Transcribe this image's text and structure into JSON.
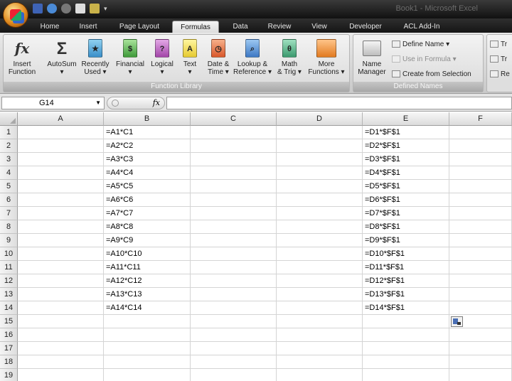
{
  "window": {
    "title": "Book1 - Microsoft Excel"
  },
  "tabs": [
    "Home",
    "Insert",
    "Page Layout",
    "Formulas",
    "Data",
    "Review",
    "View",
    "Developer",
    "ACL Add-In"
  ],
  "active_tab": "Formulas",
  "ribbon": {
    "function_library": {
      "label": "Function Library",
      "buttons": [
        {
          "line1": "Insert",
          "line2": "Function"
        },
        {
          "line1": "AutoSum",
          "line2": "▾"
        },
        {
          "line1": "Recently",
          "line2": "Used ▾"
        },
        {
          "line1": "Financial",
          "line2": "▾"
        },
        {
          "line1": "Logical",
          "line2": "▾"
        },
        {
          "line1": "Text",
          "line2": "▾"
        },
        {
          "line1": "Date &",
          "line2": "Time ▾"
        },
        {
          "line1": "Lookup &",
          "line2": "Reference ▾"
        },
        {
          "line1": "Math",
          "line2": "& Trig ▾"
        },
        {
          "line1": "More",
          "line2": "Functions ▾"
        }
      ]
    },
    "defined_names": {
      "label": "Defined Names",
      "name_manager": {
        "line1": "Name",
        "line2": "Manager"
      },
      "define_name": "Define Name ▾",
      "use_in_formula": "Use in Formula ▾",
      "create_from_selection": "Create from Selection"
    },
    "formula_auditing": {
      "items": [
        "Tr",
        "Tr",
        "Re"
      ]
    }
  },
  "name_box": "G14",
  "formula_bar": {
    "fx": "fx",
    "content": ""
  },
  "columns": [
    "A",
    "B",
    "C",
    "D",
    "E",
    "F"
  ],
  "rows": [
    {
      "n": "1",
      "B": "=A1*C1",
      "E": "=D1*$F$1"
    },
    {
      "n": "2",
      "B": "=A2*C2",
      "E": "=D2*$F$1"
    },
    {
      "n": "3",
      "B": "=A3*C3",
      "E": "=D3*$F$1"
    },
    {
      "n": "4",
      "B": "=A4*C4",
      "E": "=D4*$F$1"
    },
    {
      "n": "5",
      "B": "=A5*C5",
      "E": "=D5*$F$1"
    },
    {
      "n": "6",
      "B": "=A6*C6",
      "E": "=D6*$F$1"
    },
    {
      "n": "7",
      "B": "=A7*C7",
      "E": "=D7*$F$1"
    },
    {
      "n": "8",
      "B": "=A8*C8",
      "E": "=D8*$F$1"
    },
    {
      "n": "9",
      "B": "=A9*C9",
      "E": "=D9*$F$1"
    },
    {
      "n": "10",
      "B": "=A10*C10",
      "E": "=D10*$F$1"
    },
    {
      "n": "11",
      "B": "=A11*C11",
      "E": "=D11*$F$1"
    },
    {
      "n": "12",
      "B": "=A12*C12",
      "E": "=D12*$F$1"
    },
    {
      "n": "13",
      "B": "=A13*C13",
      "E": "=D13*$F$1"
    },
    {
      "n": "14",
      "B": "=A14*C14",
      "E": "=D14*$F$1"
    },
    {
      "n": "15",
      "B": "",
      "E": ""
    },
    {
      "n": "16",
      "B": "",
      "E": ""
    },
    {
      "n": "17",
      "B": "",
      "E": ""
    },
    {
      "n": "18",
      "B": "",
      "E": ""
    },
    {
      "n": "19",
      "B": "",
      "E": ""
    }
  ],
  "colors": {
    "accent": "#e08a1e",
    "active_tab": "#ececec"
  }
}
